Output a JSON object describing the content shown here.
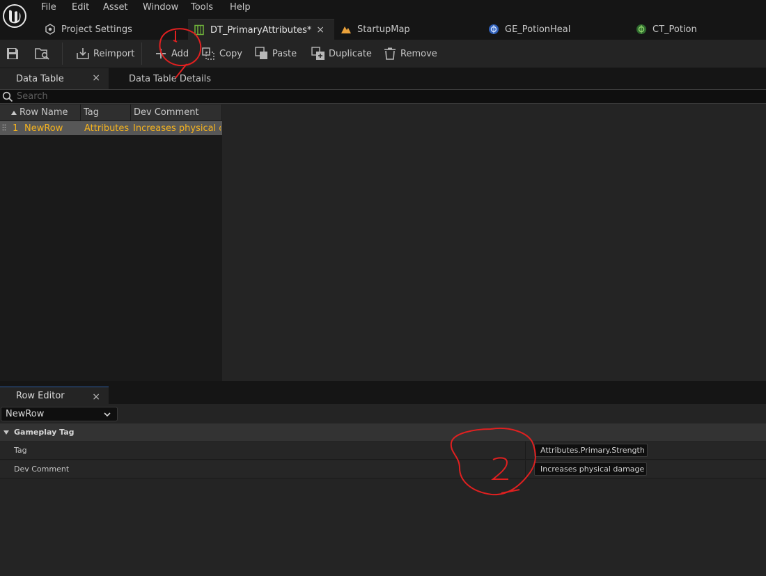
{
  "menu": [
    "File",
    "Edit",
    "Asset",
    "Window",
    "Tools",
    "Help"
  ],
  "document_tabs": {
    "project_settings": "Project Settings",
    "data_table": "DT_PrimaryAttributes*",
    "startup_map": "StartupMap",
    "ge_potion": "GE_PotionHeal",
    "ct_potion": "CT_Potion",
    "close_glyph": "×"
  },
  "toolbar": {
    "reimport": "Reimport",
    "add": "Add",
    "copy": "Copy",
    "paste": "Paste",
    "duplicate": "Duplicate",
    "remove": "Remove"
  },
  "panels": {
    "data_table": "Data Table",
    "data_table_details": "Data Table Details",
    "row_editor": "Row Editor"
  },
  "search": {
    "placeholder": "Search"
  },
  "table": {
    "columns": [
      "Row Name",
      "Tag",
      "Dev Comment"
    ],
    "rows": [
      {
        "index": "1",
        "row_name": "NewRow",
        "tag": "Attributes.Primary.Strength",
        "dev_comment": "Increases physical damage"
      }
    ]
  },
  "row_editor": {
    "selected_row": "NewRow",
    "category": "Gameplay Tag",
    "properties": [
      {
        "label": "Tag",
        "value": "Attributes.Primary.Strength"
      },
      {
        "label": "Dev Comment",
        "value": "Increases physical damage"
      }
    ]
  },
  "colors": {
    "accent_selected_text": "#f5b31e",
    "annotation_ink": "#e02020"
  },
  "icons": {
    "logo": "unreal-logo-icon",
    "save": "save-icon",
    "browse": "browse-asset-icon",
    "reimport": "reimport-icon",
    "add": "plus-icon",
    "copy": "copy-icon",
    "paste": "paste-icon",
    "duplicate": "duplicate-icon",
    "remove": "trash-icon",
    "search": "search-icon"
  }
}
